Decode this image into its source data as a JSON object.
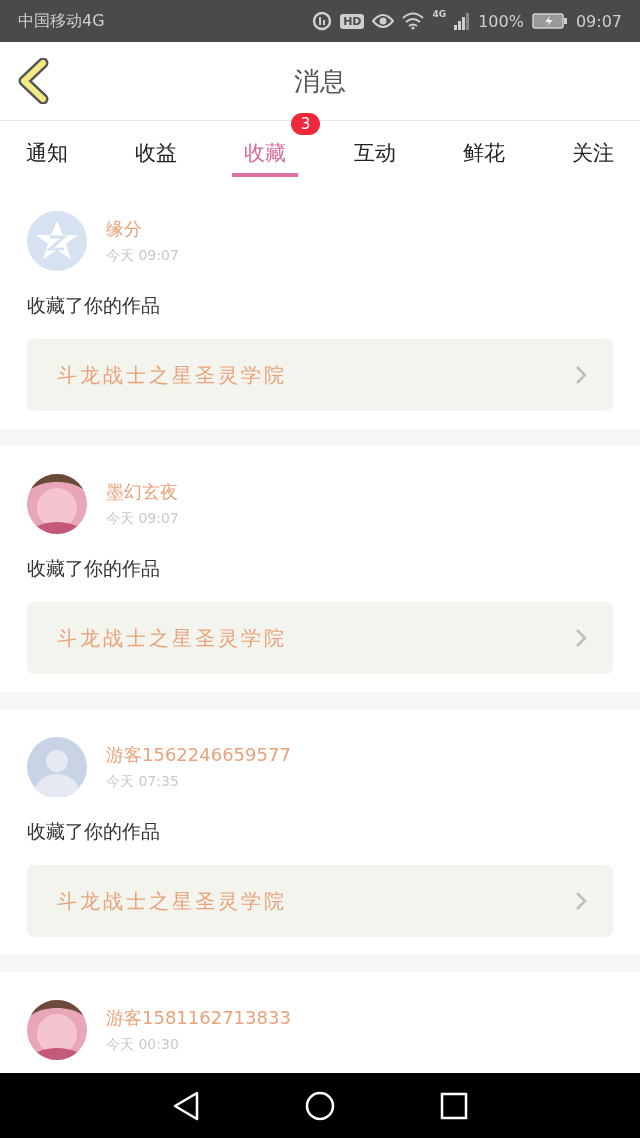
{
  "status_bar": {
    "carrier": "中国移动4G",
    "hd": "HD",
    "network": "4G",
    "battery": "100%",
    "time": "09:07"
  },
  "header": {
    "title": "消息"
  },
  "tabs": [
    {
      "label": "通知",
      "selected": false
    },
    {
      "label": "收益",
      "selected": false
    },
    {
      "label": "收藏",
      "selected": true,
      "badge": "3"
    },
    {
      "label": "互动",
      "selected": false
    },
    {
      "label": "鲜花",
      "selected": false
    },
    {
      "label": "关注",
      "selected": false
    }
  ],
  "messages": [
    {
      "kind": "star",
      "name": "缘分",
      "time": "今天 09:07",
      "text": "收藏了你的作品",
      "work": "斗龙战士之星圣灵学院"
    },
    {
      "kind": "picture",
      "name": "墨幻玄夜",
      "time": "今天 09:07",
      "text": "收藏了你的作品",
      "work": "斗龙战士之星圣灵学院"
    },
    {
      "kind": "silhouette",
      "name": "游客1562246659577",
      "time": "今天 07:35",
      "text": "收藏了你的作品",
      "work": "斗龙战士之星圣灵学院"
    },
    {
      "kind": "picture",
      "name": "游客1581162713833",
      "time": "今天 00:30"
    }
  ]
}
